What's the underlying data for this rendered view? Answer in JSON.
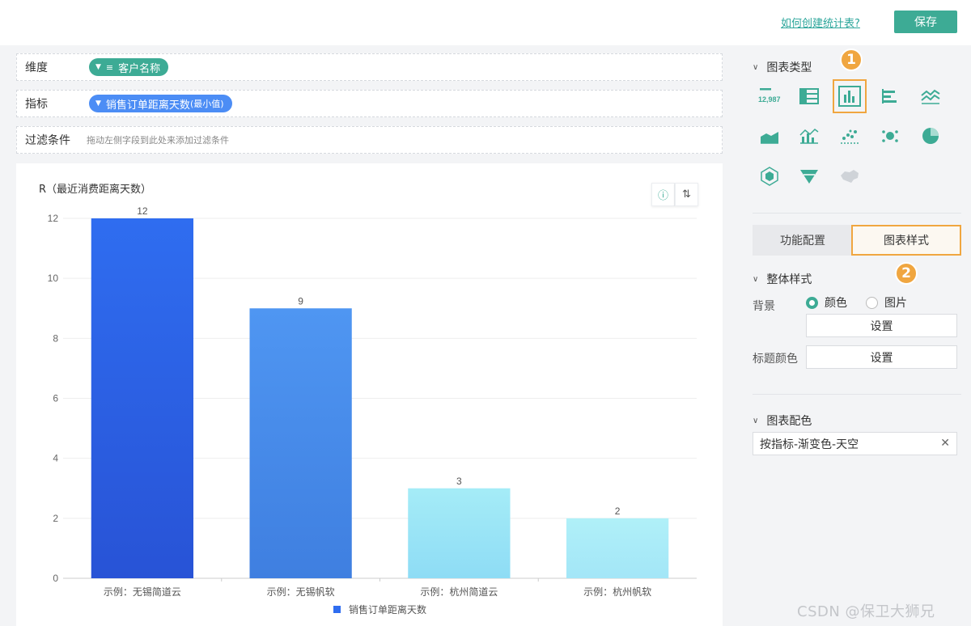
{
  "header": {
    "help_link": "如何创建统计表?",
    "save_label": "保存"
  },
  "fields": {
    "dimension_label": "维度",
    "dimension_pill": "客户名称",
    "metric_label": "指标",
    "metric_pill": "销售订单距离天数",
    "metric_suffix": "(最小值)",
    "filter_label": "过滤条件",
    "filter_hint": "拖动左侧字段到此处来添加过滤条件"
  },
  "chart_data": {
    "type": "bar",
    "title": "R（最近消费距离天数）",
    "categories": [
      "示例：无锡简道云",
      "示例：无锡帆软",
      "示例：杭州简道云",
      "示例：杭州帆软"
    ],
    "series": [
      {
        "name": "销售订单距离天数",
        "values": [
          12,
          9,
          3,
          2
        ]
      }
    ],
    "ylim": [
      0,
      12
    ],
    "yticks": [
      0,
      2,
      4,
      6,
      8,
      10,
      12
    ],
    "grid": true,
    "legend": "bottom",
    "colors": {
      "top": [
        "#2f6df0",
        "#4f96f2",
        "#a5ecf7",
        "#b0f0f8"
      ],
      "bottom": [
        "#2853d6",
        "#3f7fe0",
        "#8edcf5",
        "#a3e6f7"
      ]
    }
  },
  "sidebar": {
    "chart_type_title": "图表类型",
    "chart_types": [
      "number-card-icon",
      "table-icon",
      "bar-chart-icon",
      "horizontal-bar-icon",
      "line-chart-icon",
      "area-chart-icon",
      "combo-chart-icon",
      "scatter-icon",
      "bubble-icon",
      "pie-chart-icon",
      "radar-icon",
      "funnel-icon",
      "map-icon"
    ],
    "number_card_text": "12,987",
    "badge_1": "1",
    "badge_2": "2",
    "tab_config": "功能配置",
    "tab_style": "图表样式",
    "overall_style_title": "整体样式",
    "background_label": "背景",
    "radio_color": "颜色",
    "radio_image": "图片",
    "set_button": "设置",
    "title_color_label": "标题颜色",
    "chart_color_title": "图表配色",
    "chart_color_value": "按指标-渐变色-天空"
  },
  "watermark": "CSDN @保卫大狮兄",
  "accent": "#3dab95",
  "highlight": "#f0a640"
}
